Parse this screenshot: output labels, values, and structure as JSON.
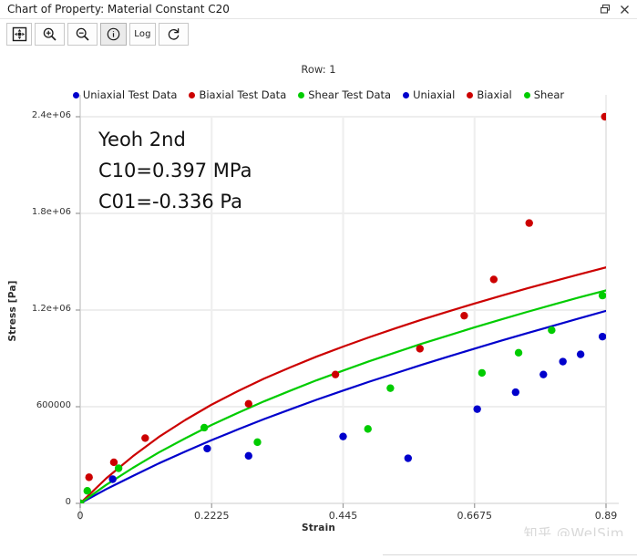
{
  "window": {
    "title": "Chart of Property: Material Constant C20",
    "restore_icon": "restore-icon",
    "close_icon": "close-icon"
  },
  "toolbar": {
    "buttons": [
      {
        "name": "fit-to-window-button",
        "icon": "fit-to-window-icon",
        "label": "",
        "active": false
      },
      {
        "name": "zoom-in-button",
        "icon": "zoom-in-icon",
        "label": "",
        "active": false
      },
      {
        "name": "zoom-out-button",
        "icon": "zoom-out-icon",
        "label": "",
        "active": false
      },
      {
        "name": "info-button",
        "icon": "info-circle-icon",
        "label": "",
        "active": true
      },
      {
        "name": "log-scale-button",
        "icon": "text-label",
        "label": "Log",
        "active": false
      },
      {
        "name": "refresh-button",
        "icon": "refresh-icon",
        "label": "",
        "active": false
      }
    ]
  },
  "chart_data": {
    "type": "scatter",
    "title": "Row: 1",
    "xlabel": "Strain",
    "ylabel": "Stress [Pa]",
    "xlim": [
      0,
      0.89
    ],
    "ylim": [
      0,
      2400000
    ],
    "xticks": [
      0,
      0.2225,
      0.445,
      0.6675,
      0.89
    ],
    "xtick_labels": [
      "0",
      "0.2225",
      "0.445",
      "0.6675",
      "0.89"
    ],
    "yticks": [
      0,
      600000,
      1200000,
      1800000,
      2400000
    ],
    "ytick_labels": [
      "0",
      "600000",
      "1.2e+06",
      "1.8e+06",
      "2.4e+06"
    ],
    "grid": true,
    "legend_position": "top",
    "colors": {
      "uniaxial": "#0000CC",
      "biaxial": "#CC0000",
      "shear": "#00CC00"
    },
    "legend": [
      {
        "label": "Uniaxial Test Data",
        "color": "#0000CC",
        "marker": "circle"
      },
      {
        "label": "Biaxial Test Data",
        "color": "#CC0000",
        "marker": "circle"
      },
      {
        "label": "Shear Test Data",
        "color": "#00CC00",
        "marker": "circle"
      },
      {
        "label": "Uniaxial",
        "color": "#0000CC",
        "marker": "circle"
      },
      {
        "label": "Biaxial",
        "color": "#CC0000",
        "marker": "circle"
      },
      {
        "label": "Shear",
        "color": "#00CC00",
        "marker": "circle"
      }
    ],
    "series": [
      {
        "name": "Uniaxial Test Data",
        "type": "scatter",
        "color": "#0000CC",
        "points": [
          [
            0.0,
            0
          ],
          [
            0.055,
            150000
          ],
          [
            0.215,
            340000
          ],
          [
            0.285,
            295000
          ],
          [
            0.445,
            415000
          ],
          [
            0.555,
            280000
          ],
          [
            0.672,
            585000
          ],
          [
            0.737,
            690000
          ],
          [
            0.784,
            800000
          ],
          [
            0.817,
            880000
          ],
          [
            0.847,
            925000
          ],
          [
            0.884,
            1035000
          ]
        ]
      },
      {
        "name": "Biaxial Test Data",
        "type": "scatter",
        "color": "#CC0000",
        "points": [
          [
            0.0,
            0
          ],
          [
            0.015,
            162000
          ],
          [
            0.057,
            255000
          ],
          [
            0.11,
            405000
          ],
          [
            0.285,
            618000
          ],
          [
            0.432,
            800000
          ],
          [
            0.575,
            960000
          ],
          [
            0.65,
            1165000
          ],
          [
            0.7,
            1390000
          ],
          [
            0.76,
            1740000
          ],
          [
            0.888,
            2400000
          ]
        ]
      },
      {
        "name": "Shear Test Data",
        "type": "scatter",
        "color": "#00CC00",
        "points": [
          [
            0.0,
            0
          ],
          [
            0.012,
            78000
          ],
          [
            0.065,
            218000
          ],
          [
            0.21,
            470000
          ],
          [
            0.3,
            380000
          ],
          [
            0.487,
            462000
          ],
          [
            0.525,
            715000
          ],
          [
            0.68,
            810000
          ],
          [
            0.742,
            935000
          ],
          [
            0.798,
            1075000
          ],
          [
            0.884,
            1290000
          ]
        ]
      },
      {
        "name": "Uniaxial",
        "type": "line",
        "color": "#0000CC",
        "points": [
          [
            0.0,
            0
          ],
          [
            0.044,
            88000
          ],
          [
            0.089,
            170000
          ],
          [
            0.133,
            248000
          ],
          [
            0.178,
            322000
          ],
          [
            0.222,
            392000
          ],
          [
            0.267,
            459000
          ],
          [
            0.311,
            523000
          ],
          [
            0.356,
            584000
          ],
          [
            0.4,
            643000
          ],
          [
            0.445,
            700000
          ],
          [
            0.489,
            755000
          ],
          [
            0.534,
            808000
          ],
          [
            0.578,
            860000
          ],
          [
            0.623,
            911000
          ],
          [
            0.667,
            960000
          ],
          [
            0.712,
            1009000
          ],
          [
            0.756,
            1056000
          ],
          [
            0.801,
            1103000
          ],
          [
            0.845,
            1149000
          ],
          [
            0.89,
            1195000
          ]
        ]
      },
      {
        "name": "Biaxial",
        "type": "line",
        "color": "#CC0000",
        "points": [
          [
            0.0,
            0
          ],
          [
            0.044,
            155000
          ],
          [
            0.089,
            292000
          ],
          [
            0.133,
            412000
          ],
          [
            0.178,
            518000
          ],
          [
            0.222,
            612000
          ],
          [
            0.267,
            697000
          ],
          [
            0.311,
            774000
          ],
          [
            0.356,
            845000
          ],
          [
            0.4,
            911000
          ],
          [
            0.445,
            973000
          ],
          [
            0.489,
            1031000
          ],
          [
            0.534,
            1087000
          ],
          [
            0.578,
            1140000
          ],
          [
            0.623,
            1191000
          ],
          [
            0.667,
            1240000
          ],
          [
            0.712,
            1288000
          ],
          [
            0.756,
            1334000
          ],
          [
            0.801,
            1379000
          ],
          [
            0.845,
            1422000
          ],
          [
            0.89,
            1465000
          ]
        ]
      },
      {
        "name": "Shear",
        "type": "line",
        "color": "#00CC00",
        "points": [
          [
            0.0,
            0
          ],
          [
            0.044,
            115000
          ],
          [
            0.089,
            220000
          ],
          [
            0.133,
            316000
          ],
          [
            0.178,
            404000
          ],
          [
            0.222,
            486000
          ],
          [
            0.267,
            562000
          ],
          [
            0.311,
            633000
          ],
          [
            0.356,
            700000
          ],
          [
            0.4,
            764000
          ],
          [
            0.445,
            824000
          ],
          [
            0.489,
            882000
          ],
          [
            0.534,
            937000
          ],
          [
            0.578,
            991000
          ],
          [
            0.623,
            1042000
          ],
          [
            0.667,
            1092000
          ],
          [
            0.712,
            1141000
          ],
          [
            0.756,
            1188000
          ],
          [
            0.801,
            1234000
          ],
          [
            0.845,
            1279000
          ],
          [
            0.89,
            1322000
          ]
        ]
      }
    ],
    "annotations": [
      "Yeoh 2nd",
      "C10=0.397 MPa",
      "C01=-0.336 Pa"
    ]
  },
  "watermark": "知乎 @WelSim"
}
